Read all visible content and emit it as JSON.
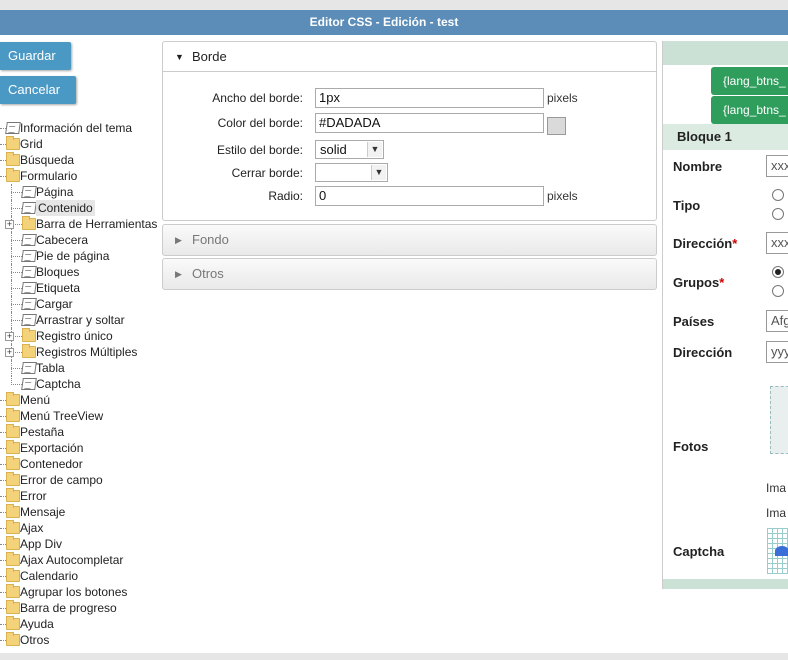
{
  "window": {
    "title": "Editor CSS - Edición - test"
  },
  "actions": {
    "save": "Guardar",
    "cancel": "Cancelar"
  },
  "tree": [
    {
      "label": "Información del tema",
      "icon": "page-icon",
      "level": 0
    },
    {
      "label": "Grid",
      "icon": "folder-icon",
      "level": 0
    },
    {
      "label": "Búsqueda",
      "icon": "folder-icon",
      "level": 0
    },
    {
      "label": "Formulario",
      "icon": "folder-open-icon",
      "level": 0
    },
    {
      "label": "Página",
      "icon": "page-icon",
      "level": 1
    },
    {
      "label": "Contenido",
      "icon": "page-icon",
      "level": 1,
      "selected": true
    },
    {
      "label": "Barra de Herramientas",
      "icon": "folder-icon",
      "level": 1,
      "expandable": true
    },
    {
      "label": "Cabecera",
      "icon": "page-icon",
      "level": 1
    },
    {
      "label": "Pie de página",
      "icon": "page-icon",
      "level": 1
    },
    {
      "label": "Bloques",
      "icon": "page-icon",
      "level": 1
    },
    {
      "label": "Etiqueta",
      "icon": "page-icon",
      "level": 1
    },
    {
      "label": "Cargar",
      "icon": "page-icon",
      "level": 1
    },
    {
      "label": "Arrastrar y soltar",
      "icon": "page-icon",
      "level": 1
    },
    {
      "label": "Registro único",
      "icon": "folder-icon",
      "level": 1,
      "expandable": true
    },
    {
      "label": "Registros Múltiples",
      "icon": "folder-icon",
      "level": 1,
      "expandable": true
    },
    {
      "label": "Tabla",
      "icon": "page-icon",
      "level": 1
    },
    {
      "label": "Captcha",
      "icon": "page-icon",
      "level": 1
    },
    {
      "label": "Menú",
      "icon": "folder-icon",
      "level": 0
    },
    {
      "label": "Menú TreeView",
      "icon": "folder-icon",
      "level": 0
    },
    {
      "label": "Pestaña",
      "icon": "folder-icon",
      "level": 0
    },
    {
      "label": "Exportación",
      "icon": "folder-icon",
      "level": 0
    },
    {
      "label": "Contenedor",
      "icon": "folder-icon",
      "level": 0
    },
    {
      "label": "Error de campo",
      "icon": "folder-icon",
      "level": 0
    },
    {
      "label": "Error",
      "icon": "folder-icon",
      "level": 0
    },
    {
      "label": "Mensaje",
      "icon": "folder-icon",
      "level": 0
    },
    {
      "label": "Ajax",
      "icon": "folder-icon",
      "level": 0
    },
    {
      "label": "App Div",
      "icon": "folder-icon",
      "level": 0
    },
    {
      "label": "Ajax Autocompletar",
      "icon": "folder-icon",
      "level": 0
    },
    {
      "label": "Calendario",
      "icon": "folder-icon",
      "level": 0
    },
    {
      "label": "Agrupar los botones",
      "icon": "folder-icon",
      "level": 0
    },
    {
      "label": "Barra de progreso",
      "icon": "folder-icon",
      "level": 0
    },
    {
      "label": "Ayuda",
      "icon": "folder-icon",
      "level": 0
    },
    {
      "label": "Otros",
      "icon": "folder-icon",
      "level": 0
    }
  ],
  "border_panel": {
    "title": "Borde",
    "width_label": "Ancho del borde:",
    "width_value": "1px",
    "width_unit": "pixels",
    "color_label": "Color del borde:",
    "color_value": "#DADADA",
    "style_label": "Estilo del borde:",
    "style_value": "solid",
    "close_label": "Cerrar borde:",
    "close_value": "",
    "radius_label": "Radio:",
    "radius_value": "0",
    "radius_unit": "pixels"
  },
  "fondo_panel": {
    "title": "Fondo"
  },
  "otros_panel": {
    "title": "Otros"
  },
  "preview": {
    "button_1": "{lang_btns_",
    "button_2": "{lang_btns_",
    "block_title": "Bloque 1",
    "nombre_label": "Nombre",
    "nombre_value": "xxx",
    "tipo_label": "Tipo",
    "direccion_label": "Dirección",
    "direccion_value": "xxx",
    "required_mark": "*",
    "grupos_label": "Grupos",
    "paises_label": "Países",
    "paises_value": "Afg",
    "direccion2_label": "Dirección",
    "direccion2_value": "yyy",
    "fotos_label": "Fotos",
    "image_text_1": "Ima",
    "image_text_2": "Ima",
    "captcha_label": "Captcha"
  },
  "colors": {
    "titlebar": "#5b8db8",
    "button": "#4a98c4",
    "preview_button": "#2f9d5c",
    "swatch": "#dadada"
  }
}
